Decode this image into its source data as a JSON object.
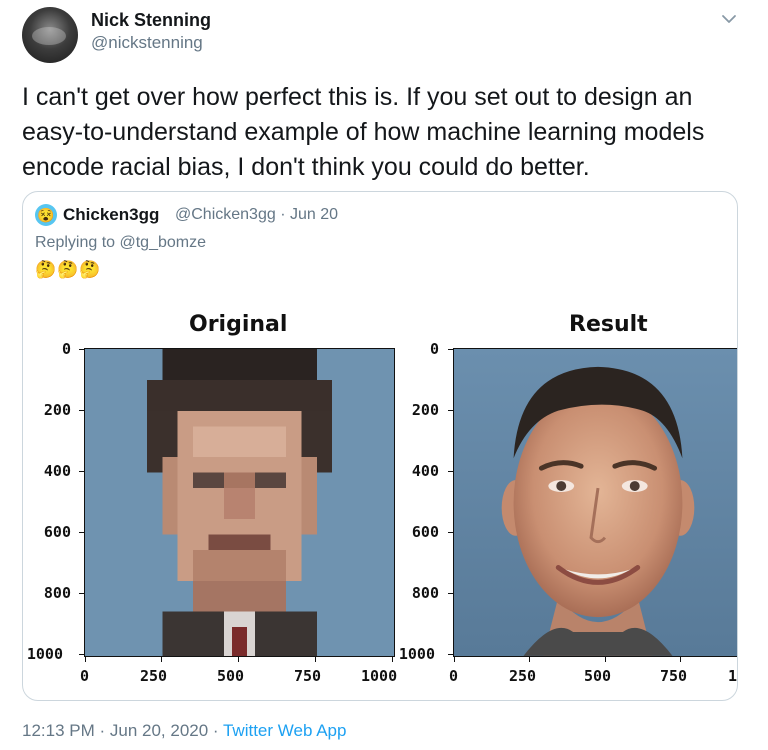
{
  "author": {
    "name": "Nick Stenning",
    "handle": "@nickstenning",
    "avatar_icon": "profile-photo"
  },
  "tweet": {
    "text": "I can't get over how perfect this is. If you set out to design an easy-to-understand example of how machine learning models encode racial bias, I don't think you could do better."
  },
  "quoted": {
    "name": "Chicken3gg",
    "handle": "@Chicken3gg",
    "date": "Jun 20",
    "replying_to": "Replying to @tg_bomze",
    "emoji": "🤔🤔🤔",
    "avatar_icon": "emoji-avatar"
  },
  "figure": {
    "left_title": "Original",
    "right_title": "Result",
    "y_ticks": [
      "0",
      "200",
      "400",
      "600",
      "800",
      "1000"
    ],
    "left_x_ticks": [
      "0",
      "250",
      "500",
      "750",
      "1000"
    ],
    "right_x_ticks": [
      "0",
      "250",
      "500",
      "750",
      "1"
    ]
  },
  "footer": {
    "time": "12:13 PM · Jun 20, 2020 · ",
    "app": "Twitter Web App"
  },
  "colors": {
    "link": "#1da1f2",
    "muted": "#657786",
    "border": "#ccd6dd"
  }
}
